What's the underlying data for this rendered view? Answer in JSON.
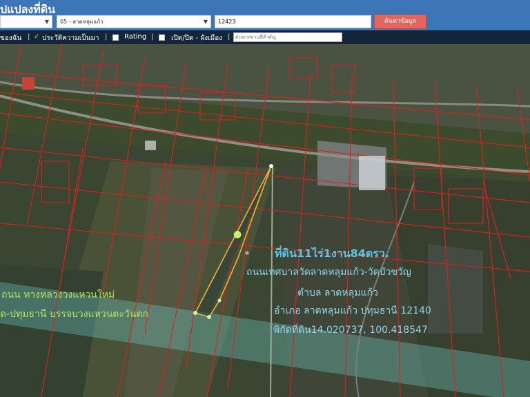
{
  "header": {
    "title": "ปแปลงที่ดิน",
    "province_select": "",
    "district_select": "05 - ลาดหลุมแก้ว",
    "parcel_no": "12423",
    "search_button": "ค้นหาข้อมูล"
  },
  "toolbar": {
    "item1": "ของฉัน",
    "item2": "ประวัติความเป็นมา",
    "item3": "Rating",
    "item4": "เปิด/ปิด - ผังเมือง",
    "place_placeholder": "ค้นหาสถานที่สำคัญ"
  },
  "map": {
    "info_line1": "ที่ดิน11ไร่1งาน84ตรว.",
    "info_line2": "ถนนเทศบาลวัดลาดหลุมแก้ว-วัดบัวขวัญ",
    "info_line3": "ตำบล ลาดหลุมแก้ว",
    "info_line4": "อำเภอ ลาดหลุมแก้ว ปทุมธานี 12140",
    "info_line5": "พิกัดที่ดิน14.020737, 100.418547",
    "road_line1": "ถนน ทางหลวงวงแหวนใหม่",
    "road_line2": "ด-ปทุมธานี บรรจบวงแหวนตะวันตก",
    "pin_icon": "map-pin-icon"
  }
}
